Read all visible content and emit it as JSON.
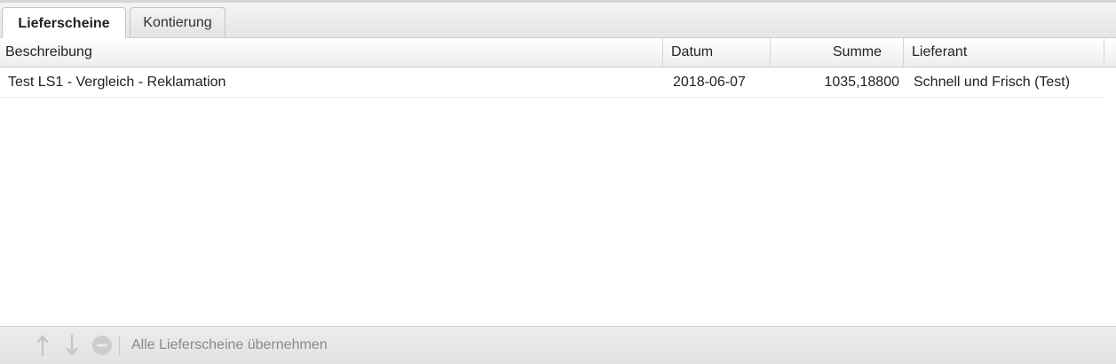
{
  "tabs": [
    {
      "label": "Lieferscheine",
      "active": true
    },
    {
      "label": "Kontierung",
      "active": false
    }
  ],
  "grid": {
    "columns": [
      "Beschreibung",
      "Datum",
      "Summe",
      "Lieferant"
    ],
    "rows": [
      {
        "description": "Test LS1 - Vergleich - Reklamation",
        "date": "2018-06-07",
        "sum": "1035,18800",
        "supplier": "Schnell und Frisch (Test)"
      }
    ]
  },
  "toolbar": {
    "buttons": [
      {
        "icon": "arrow-up-icon",
        "enabled": false
      },
      {
        "icon": "arrow-down-icon",
        "enabled": false
      },
      {
        "icon": "remove-icon",
        "enabled": false
      }
    ],
    "label": "Alle Lieferscheine übernehmen"
  },
  "colors": {
    "disabled_icon": "#c4c4c4",
    "disabled_text": "#8a8a8a",
    "border": "#d0d0d0"
  }
}
